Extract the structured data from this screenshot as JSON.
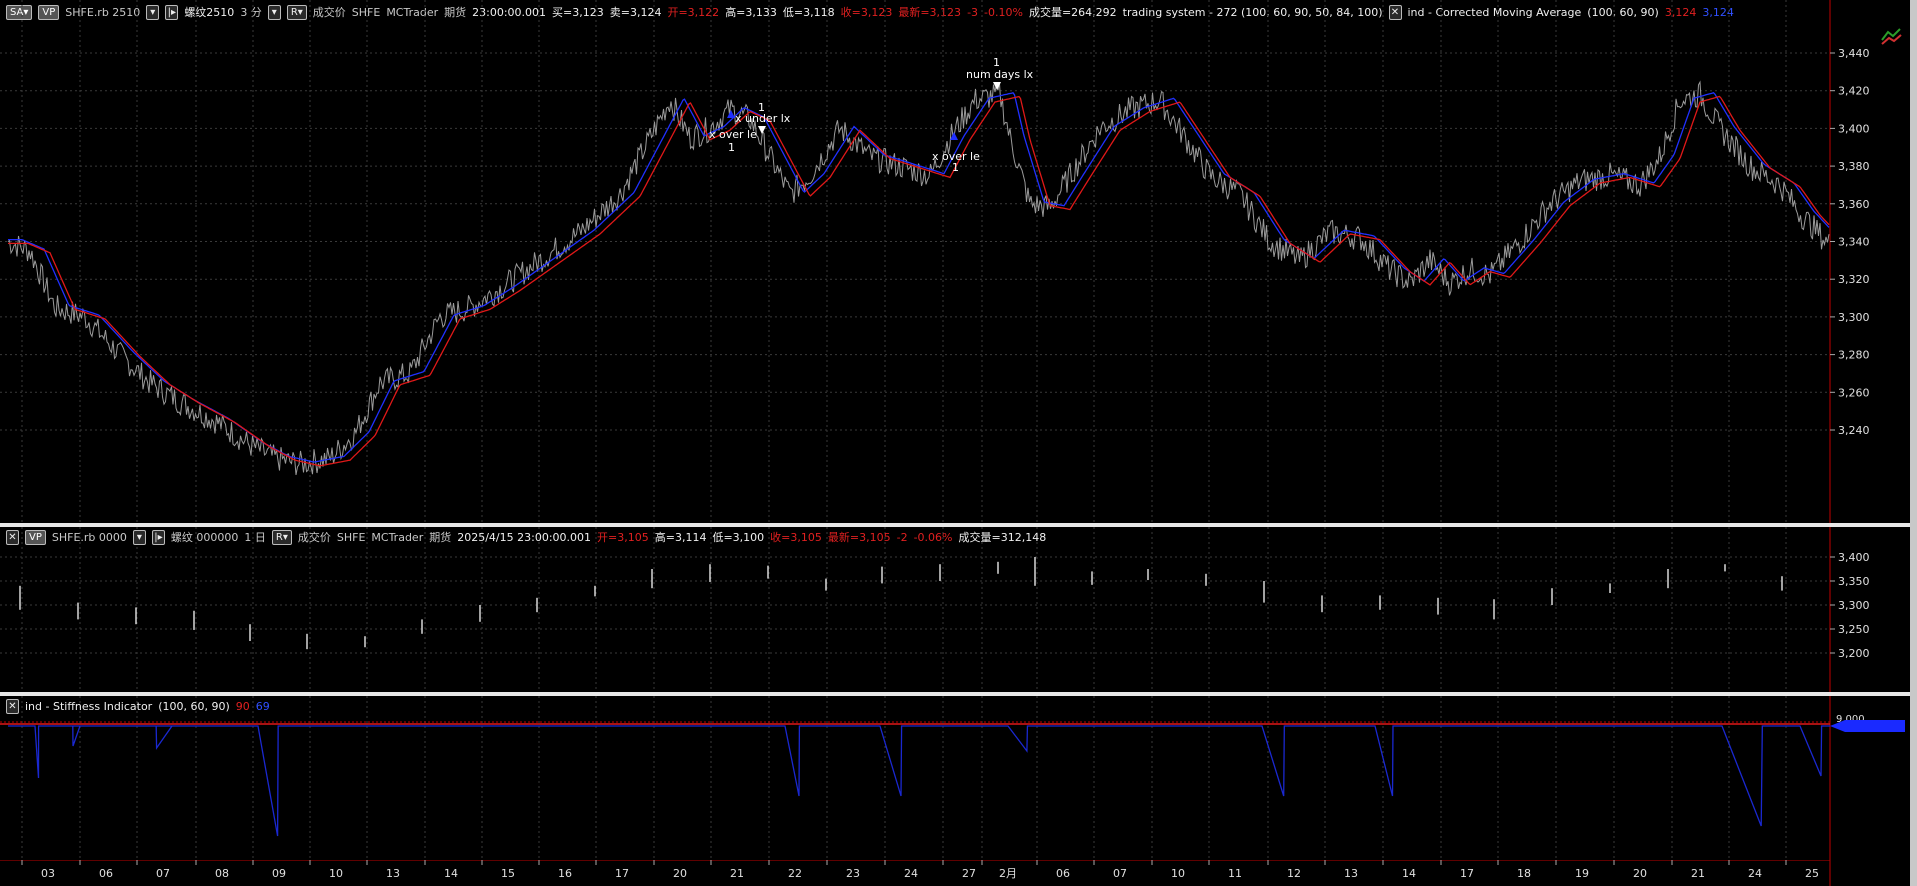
{
  "main_pane": {
    "symbol_btn": "SA",
    "vp_btn": "VP",
    "symbol": "SHFE.rb 2510",
    "name": "螺纹2510",
    "interval": "3 分",
    "price_type": "成交价",
    "exchange": "SHFE",
    "feed": "MCTrader",
    "category": "期货",
    "time": "23:00:00.001",
    "bid": "买=3,123",
    "ask": "卖=3,124",
    "open": "开=3,122",
    "high": "高=3,133",
    "low": "低=3,118",
    "close": "收=3,123",
    "last": "最新=3,123",
    "change": "-3",
    "change_pct": "-0.10%",
    "volume": "成交量=264,292",
    "strategy": "trading system - 272 (100,  60,  90,  50,  84,  100)",
    "indicator": "ind - Corrected Moving Average",
    "indicator_params": "(100,  60,  90)",
    "ind_val1": "3,124",
    "ind_val2": "3,124",
    "y_ticks": [
      "3,440",
      "3,420",
      "3,400",
      "3,380",
      "3,360",
      "3,340",
      "3,320",
      "3,300",
      "3,280",
      "3,260",
      "3,240"
    ],
    "annotations": {
      "num_days": "num days lx",
      "x_under": "x under lx",
      "x_over_1": "x over le",
      "x_over_2": "x over le",
      "one_a": "1",
      "one_b": "1",
      "one_c": "1",
      "one_d": "1"
    }
  },
  "daily_pane": {
    "vp_btn": "VP",
    "symbol": "SHFE.rb 0000",
    "name": "螺纹 000000",
    "interval": "1 日",
    "price_type": "成交价",
    "exchange": "SHFE",
    "feed": "MCTrader",
    "category": "期货",
    "time": "2025/4/15  23:00:00.001",
    "open": "开=3,105",
    "high": "高=3,114",
    "low": "低=3,100",
    "close": "收=3,105",
    "last": "最新=3,105",
    "change": "-2",
    "change_pct": "-0.06%",
    "volume": "成交量=312,148",
    "y_ticks": [
      "3,400",
      "3,350",
      "3,300",
      "3,250",
      "3,200"
    ]
  },
  "stiffness_pane": {
    "title": "ind - Stiffness Indicator",
    "params": "(100,  60,  90)",
    "val1": "90",
    "val2": "69",
    "y_label": "9,000"
  },
  "x_axis": {
    "labels": [
      "03",
      "06",
      "07",
      "08",
      "09",
      "10",
      "13",
      "14",
      "15",
      "16",
      "17",
      "20",
      "21",
      "22",
      "23",
      "24",
      "27",
      "2月",
      "06",
      "07",
      "10",
      "11",
      "12",
      "13",
      "14",
      "17",
      "18",
      "19",
      "20",
      "21",
      "24",
      "25"
    ]
  },
  "colors": {
    "price": "#9a9a9a",
    "ma_red": "#e01818",
    "ma_blue": "#2030ff",
    "grid": "#3a3a3a",
    "last_line": "#c00000"
  }
}
